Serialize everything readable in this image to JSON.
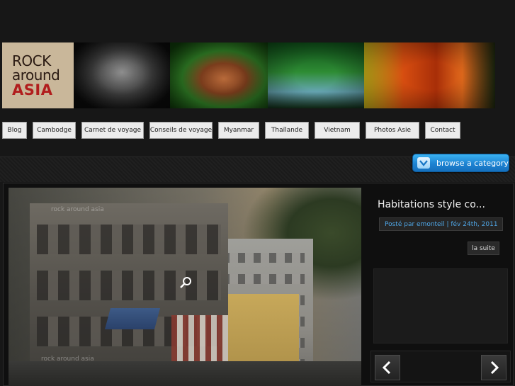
{
  "logo": {
    "line1": "ROCK",
    "line2": "around",
    "line3": "ASIA"
  },
  "nav": {
    "items": [
      {
        "label": "Blog"
      },
      {
        "label": "Cambodge"
      },
      {
        "label": "Carnet de voyage"
      },
      {
        "label": "Conseils de voyage"
      },
      {
        "label": "Myanmar"
      },
      {
        "label": "Thaïlande"
      },
      {
        "label": "Vietnam"
      },
      {
        "label": "Photos Asie"
      },
      {
        "label": "Contact"
      }
    ]
  },
  "browse": {
    "label": "browse a category"
  },
  "slider": {
    "watermark_top": "rock around asia",
    "watermark_bottom": "rock around asia",
    "post_title": "Habitations style co...",
    "meta": "Posté par emonteil | fév 24th, 2011",
    "read_more": "la suite"
  },
  "colors": {
    "accent": "#1d83d2",
    "meta_text": "#4fa6e6",
    "background": "#171717"
  },
  "icons": {
    "browse": "chevron-down-icon",
    "zoom": "zoom-icon",
    "prev": "arrow-left-icon",
    "next": "arrow-right-icon"
  }
}
